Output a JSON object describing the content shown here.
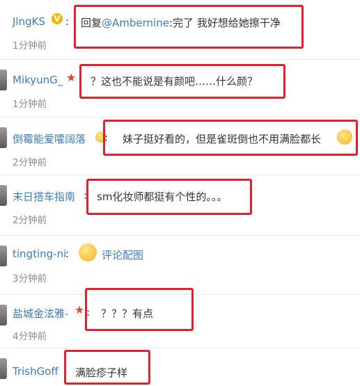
{
  "comments": [
    {
      "user": "JlngKS",
      "sep": ":",
      "reply_prefix": "回复",
      "mention": "@Ambernine",
      "text": ":完了 我好想给她擦干净",
      "time": "1分钟前"
    },
    {
      "user": "MikyunG_",
      "sep": ":",
      "text": "？这也不能说是有颜吧……什么颜？",
      "time": "1分钟前"
    },
    {
      "user": "倒霉能爱嚯阔落",
      "sep": ":",
      "text": "妹子挺好看的，但是雀斑倒也不用满脸都长",
      "time": "2分钟前"
    },
    {
      "user": "末日搭车指南",
      "sep": ":",
      "text": "sm化妆师都挺有个性的。。。",
      "time": "2分钟前"
    },
    {
      "user": "tingting-ni",
      "sep": ":",
      "image_link": "评论配图",
      "time": "3分钟前"
    },
    {
      "user": "盐城金泫雅-",
      "sep": ":",
      "text": "？？？有点",
      "time": "4分钟前"
    },
    {
      "user": "TrishGoff",
      "text": "满脸疹子样"
    }
  ],
  "icons": {
    "verified": "v-badge-icon",
    "member": "star-icon",
    "emoji": "laughing-emoji-icon",
    "image_emoji": "blushing-emoji-icon"
  },
  "colors": {
    "username": "#3a7cc2",
    "highlight": "#e3202c",
    "time": "#8a8a8a"
  }
}
